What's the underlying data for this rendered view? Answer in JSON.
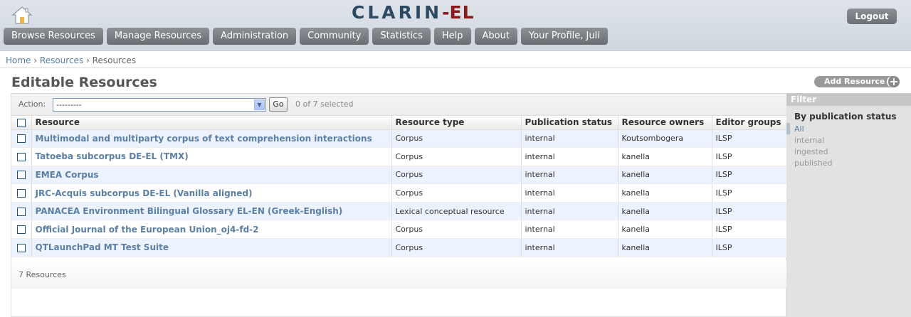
{
  "header": {
    "logo_main": "CLARIN",
    "logo_dash": "-",
    "logo_suffix": "EL",
    "logout_label": "Logout",
    "nav": [
      "Browse Resources",
      "Manage Resources",
      "Administration",
      "Community",
      "Statistics",
      "Help",
      "About",
      "Your Profile, Juli"
    ]
  },
  "breadcrumb": {
    "home": "Home",
    "resources": "Resources",
    "current": "Resources",
    "sep": "›"
  },
  "page": {
    "title": "Editable Resources",
    "add_button": "Add Resource",
    "add_plus": "+"
  },
  "actions": {
    "label": "Action:",
    "select_value": "---------",
    "go_label": "Go",
    "selected_count": "0 of 7 selected"
  },
  "table": {
    "columns": [
      "Resource",
      "Resource type",
      "Publication status",
      "Resource owners",
      "Editor groups"
    ],
    "rows": [
      {
        "name": "Multimodal and multiparty corpus of text comprehension interactions",
        "type": "Corpus",
        "status": "internal",
        "owner": "Koutsombogera",
        "group": "ILSP"
      },
      {
        "name": "Tatoeba subcorpus DE-EL (TMX)",
        "type": "Corpus",
        "status": "internal",
        "owner": "kanella",
        "group": "ILSP"
      },
      {
        "name": "EMEA Corpus",
        "type": "Corpus",
        "status": "internal",
        "owner": "kanella",
        "group": "ILSP"
      },
      {
        "name": "JRC-Acquis subcorpus DE-EL (Vanilla aligned)",
        "type": "Corpus",
        "status": "internal",
        "owner": "kanella",
        "group": "ILSP"
      },
      {
        "name": "PANACEA Environment Bilingual Glossary EL-EN (Greek-English)",
        "type": "Lexical conceptual resource",
        "status": "internal",
        "owner": "kanella",
        "group": "ILSP"
      },
      {
        "name": "Official Journal of the European Union_oj4-fd-2",
        "type": "Corpus",
        "status": "internal",
        "owner": "kanella",
        "group": "ILSP"
      },
      {
        "name": "QTLaunchPad MT Test Suite",
        "type": "Corpus",
        "status": "internal",
        "owner": "kanella",
        "group": "ILSP"
      }
    ],
    "count_text": "7 Resources"
  },
  "filter": {
    "title": "Filter",
    "subtitle": "By publication status",
    "options": [
      "All",
      "internal",
      "ingested",
      "published"
    ],
    "selected": "All"
  }
}
